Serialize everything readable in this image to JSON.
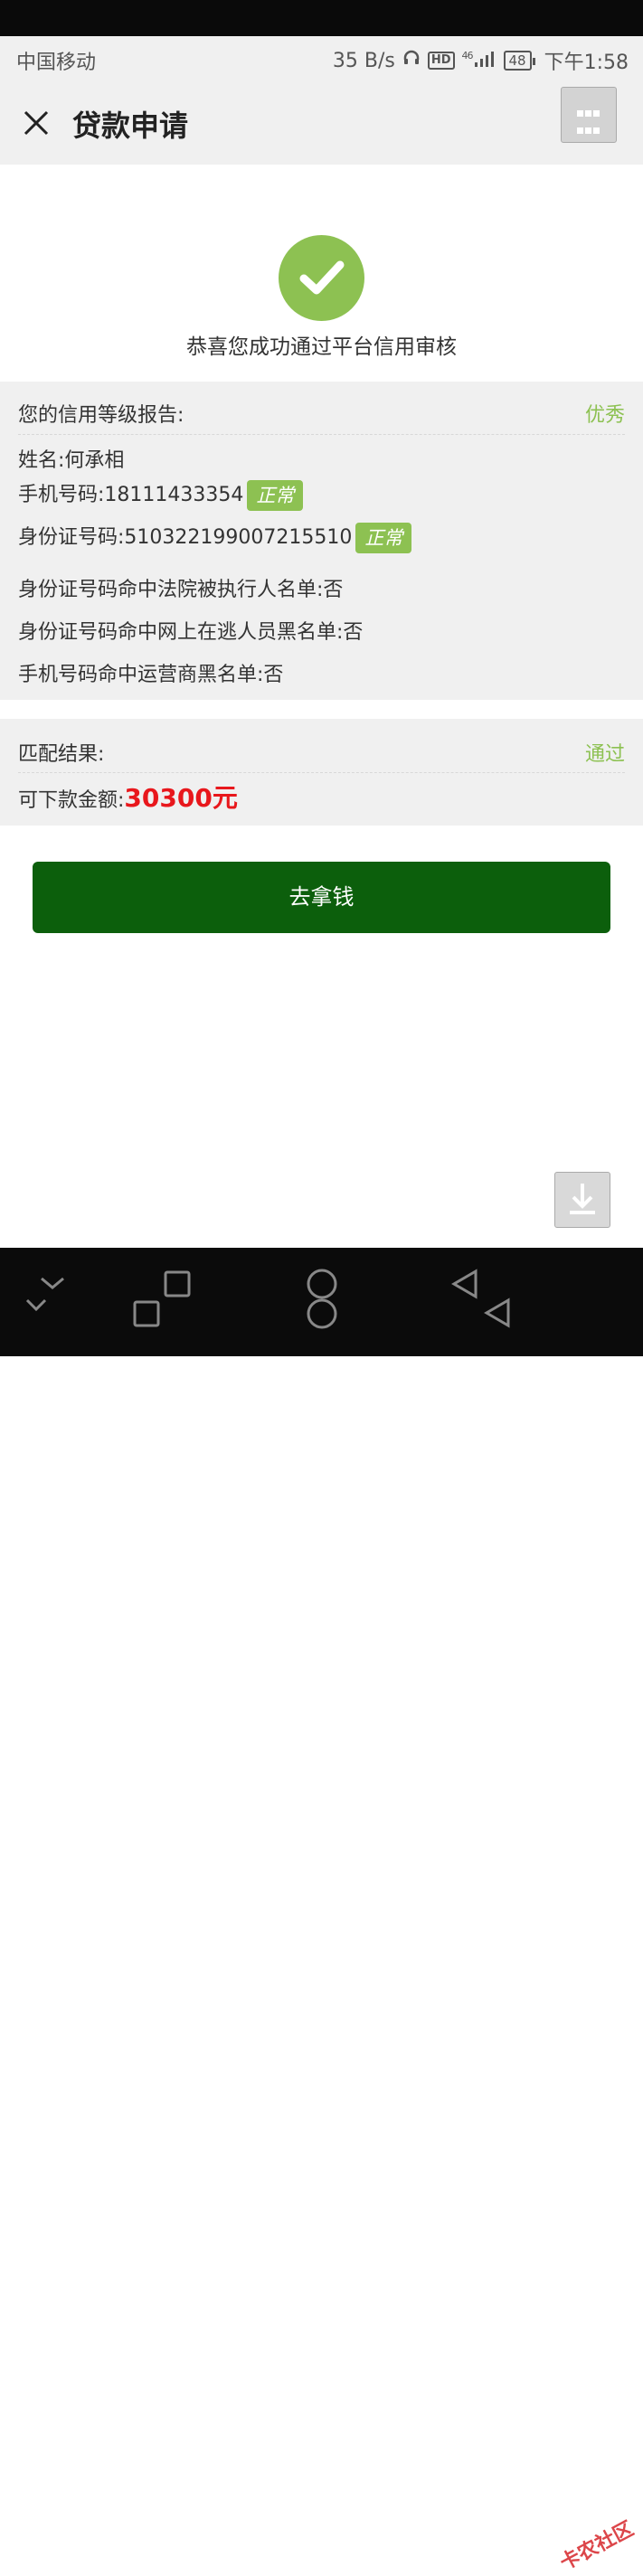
{
  "status_bar": {
    "carrier": "中国移动",
    "speed": "35 B/s",
    "hd": "HD",
    "network": "46",
    "battery": "48",
    "time": "下午1:58"
  },
  "header": {
    "title": "贷款申请",
    "close_icon": "close-icon",
    "menu_icon": "grid-menu-icon"
  },
  "success": {
    "icon": "check-circle-icon",
    "message": "恭喜您成功通过平台信用审核",
    "icon_color": "#8dc152"
  },
  "credit_report": {
    "heading": "您的信用等级报告:",
    "grade": "优秀",
    "name_label": "姓名:",
    "name_value": "何承相",
    "phone_label": "手机号码:",
    "phone_value": "18111433354",
    "phone_badge": "正常",
    "id_label": "身份证号码:",
    "id_value": "510322199007215510",
    "id_badge": "正常",
    "court_list": "身份证号码命中法院被执行人名单:否",
    "fugitive_list": "身份证号码命中网上在逃人员黑名单:否",
    "carrier_list": "手机号码命中运营商黑名单:否"
  },
  "match": {
    "heading": "匹配结果:",
    "result": "通过",
    "amount_label": "可下款金额:",
    "amount_value": "30300元"
  },
  "actions": {
    "cta_label": "去拿钱",
    "download_icon": "download-icon"
  },
  "watermark": "卡农社区",
  "colors": {
    "accent_green": "#8dc152",
    "cta_green": "#0c5f0c",
    "amount_red": "#e8171c"
  }
}
